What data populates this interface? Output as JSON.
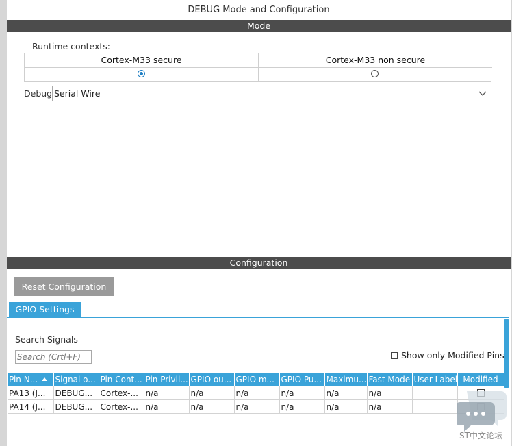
{
  "window": {
    "title": "DEBUG Mode and Configuration"
  },
  "mode": {
    "header": "Mode",
    "runtime_label": "Runtime contexts:",
    "contexts": [
      {
        "label": "Cortex-M33 secure",
        "selected": true
      },
      {
        "label": "Cortex-M33 non secure",
        "selected": false
      }
    ],
    "debug_label": "Debug",
    "debug_value": "Serial Wire"
  },
  "configuration": {
    "header": "Configuration",
    "reset_button": "Reset Configuration",
    "tab_label": "GPIO Settings",
    "search_label": "Search Signals",
    "search_placeholder": "Search (Crtl+F)",
    "show_modified_label": "Show only Modified Pins",
    "columns": [
      "Pin N...",
      "Signal o...",
      "Pin Cont...",
      "Pin Privil...",
      "GPIO ou...",
      "GPIO m...",
      "GPIO Pu...",
      "Maximu...",
      "Fast Mode",
      "User Label",
      "Modified"
    ],
    "rows": [
      [
        "PA13 (J...",
        "DEBUG...",
        "Cortex-...",
        "n/a",
        "n/a",
        "n/a",
        "n/a",
        "n/a",
        "n/a",
        ""
      ],
      [
        "PA14 (J...",
        "DEBUG...",
        "Cortex-...",
        "n/a",
        "n/a",
        "n/a",
        "n/a",
        "n/a",
        "n/a",
        ""
      ]
    ]
  },
  "watermark": {
    "text": "ST中文论坛"
  },
  "colors": {
    "accent": "#3aa3d9",
    "header_bar": "#4c4c4c",
    "button_gray": "#9a9a9a",
    "radio_selected": "#1f7fc4"
  }
}
